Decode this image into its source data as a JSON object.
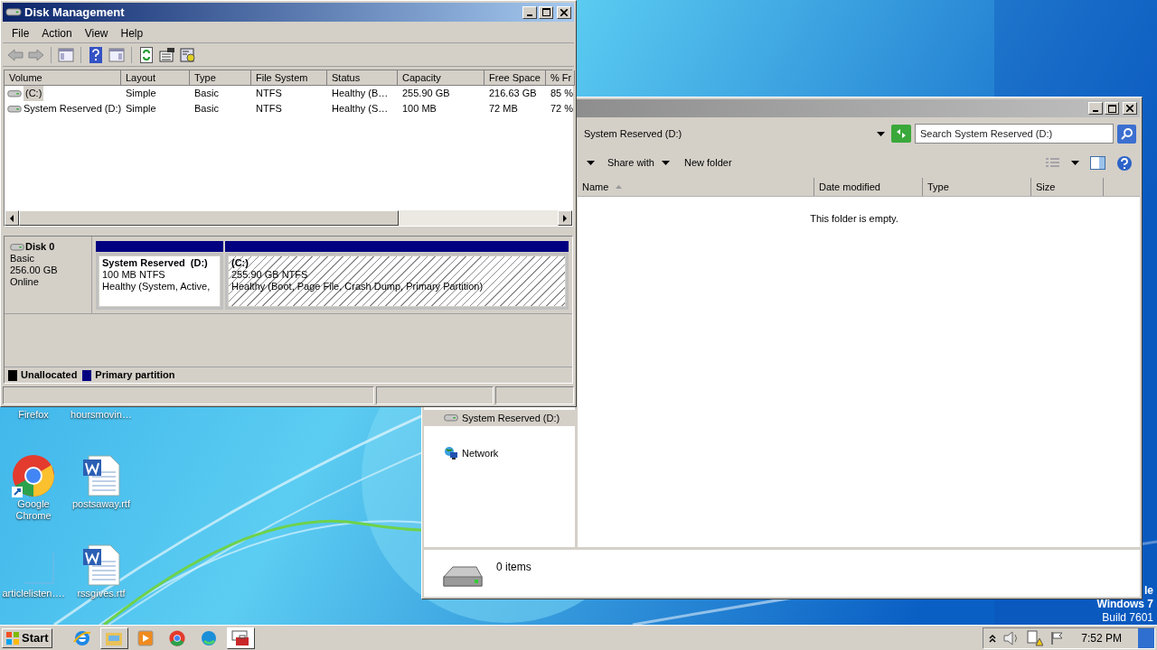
{
  "disk_management": {
    "title": "Disk Management",
    "menu": [
      "File",
      "Action",
      "View",
      "Help"
    ],
    "volume_list": {
      "columns": [
        "Volume",
        "Layout",
        "Type",
        "File System",
        "Status",
        "Capacity",
        "Free Space",
        "% Fr"
      ],
      "rows": [
        {
          "cells": [
            "(C:)",
            "Simple",
            "Basic",
            "NTFS",
            "Healthy (B…",
            "255.90 GB",
            "216.63 GB",
            "85 %"
          ],
          "selected": true
        },
        {
          "cells": [
            "System Reserved (D:)",
            "Simple",
            "Basic",
            "NTFS",
            "Healthy (S…",
            "100 MB",
            "72 MB",
            "72 %"
          ],
          "selected": false
        }
      ]
    },
    "disk": {
      "name": "Disk 0",
      "type": "Basic",
      "size": "256.00 GB",
      "status": "Online",
      "partitions": [
        {
          "name": "System Reserved  (D:)",
          "size": "100 MB NTFS",
          "status": "Healthy (System, Active,",
          "selected": false
        },
        {
          "name": "(C:)",
          "size": "255.90 GB NTFS",
          "status": "Healthy (Boot, Page File, Crash Dump, Primary Partition)",
          "selected": true
        }
      ]
    },
    "legend": [
      {
        "label": "Unallocated",
        "color": "#000000"
      },
      {
        "label": "Primary partition",
        "color": "#000080"
      }
    ]
  },
  "explorer": {
    "address": "System Reserved (D:)",
    "search": {
      "placeholder": "Search System Reserved (D:)"
    },
    "toolbar": [
      "Share with",
      "New folder"
    ],
    "columns": [
      "Name",
      "Date modified",
      "Type",
      "Size"
    ],
    "empty_message": "This folder is empty.",
    "nav": [
      {
        "label": "System Reserved (D:)",
        "kind": "drive",
        "selected": true
      },
      {
        "label": "Network",
        "kind": "network",
        "selected": false
      }
    ],
    "item_count": "0 items"
  },
  "desktop_icons": [
    {
      "label": "Firefox",
      "kind": "covered"
    },
    {
      "label": "hoursmovin…",
      "kind": "covered"
    },
    {
      "label": "Google Chrome",
      "kind": "chrome"
    },
    {
      "label": "postsaway.rtf",
      "kind": "word"
    },
    {
      "label": "articlelisten….",
      "kind": "blank"
    },
    {
      "label": "rssgives.rtf",
      "kind": "word"
    }
  ],
  "desktop_notice": [
    "le",
    "Windows 7",
    "Build 7601"
  ],
  "taskbar": {
    "start": "Start",
    "buttons": [
      {
        "kind": "ie",
        "open": false,
        "selected": false
      },
      {
        "kind": "folder",
        "open": true,
        "selected": false
      },
      {
        "kind": "media",
        "open": false,
        "selected": false
      },
      {
        "kind": "chrome",
        "open": false,
        "selected": false
      },
      {
        "kind": "edge",
        "open": false,
        "selected": false
      },
      {
        "kind": "diskmgmt",
        "open": true,
        "selected": true
      }
    ],
    "clock": "7:52 PM"
  }
}
